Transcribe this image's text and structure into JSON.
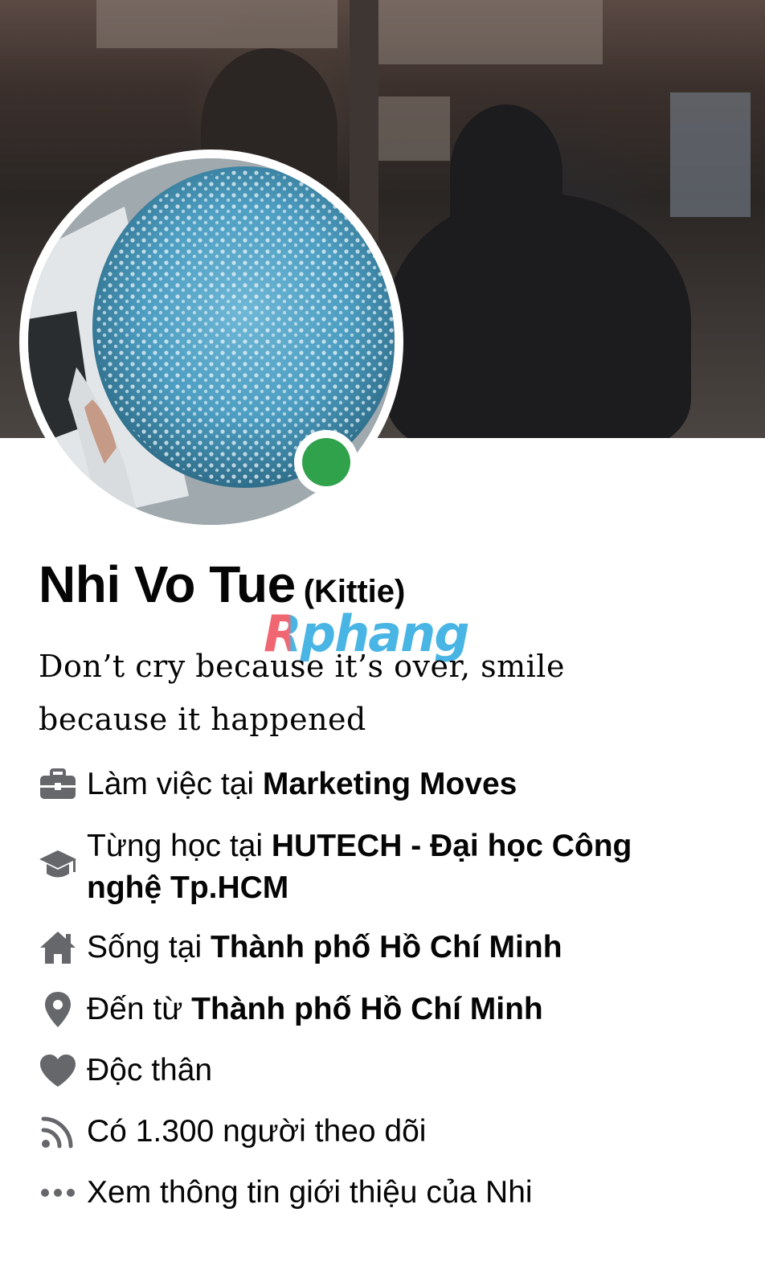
{
  "profile": {
    "name": "Nhi Vo Tue",
    "alternate_name": "(Kittie)",
    "bio": "Don’t cry because it’s over, smile because it happened",
    "online": true,
    "online_color": "#31a24c"
  },
  "watermark": "Rphang",
  "intro": {
    "work": {
      "prefix": "Làm việc tại ",
      "value": "Marketing Moves",
      "icon": "briefcase-icon"
    },
    "education": {
      "prefix": "Từng học tại ",
      "value": "HUTECH - Đại học Công nghệ Tp.HCM",
      "icon": "graduation-cap-icon"
    },
    "lives_in": {
      "prefix": "Sống tại ",
      "value": "Thành phố Hồ Chí Minh",
      "icon": "home-icon"
    },
    "from": {
      "prefix": "Đến từ ",
      "value": "Thành phố Hồ Chí Minh",
      "icon": "location-pin-icon"
    },
    "relationship": {
      "text": "Độc thân",
      "icon": "heart-icon"
    },
    "followers": {
      "text": "Có 1.300 người theo dõi",
      "icon": "rss-icon"
    },
    "see_about": {
      "text": "Xem thông tin giới thiệu của Nhi",
      "icon": "more-dots-icon"
    }
  }
}
